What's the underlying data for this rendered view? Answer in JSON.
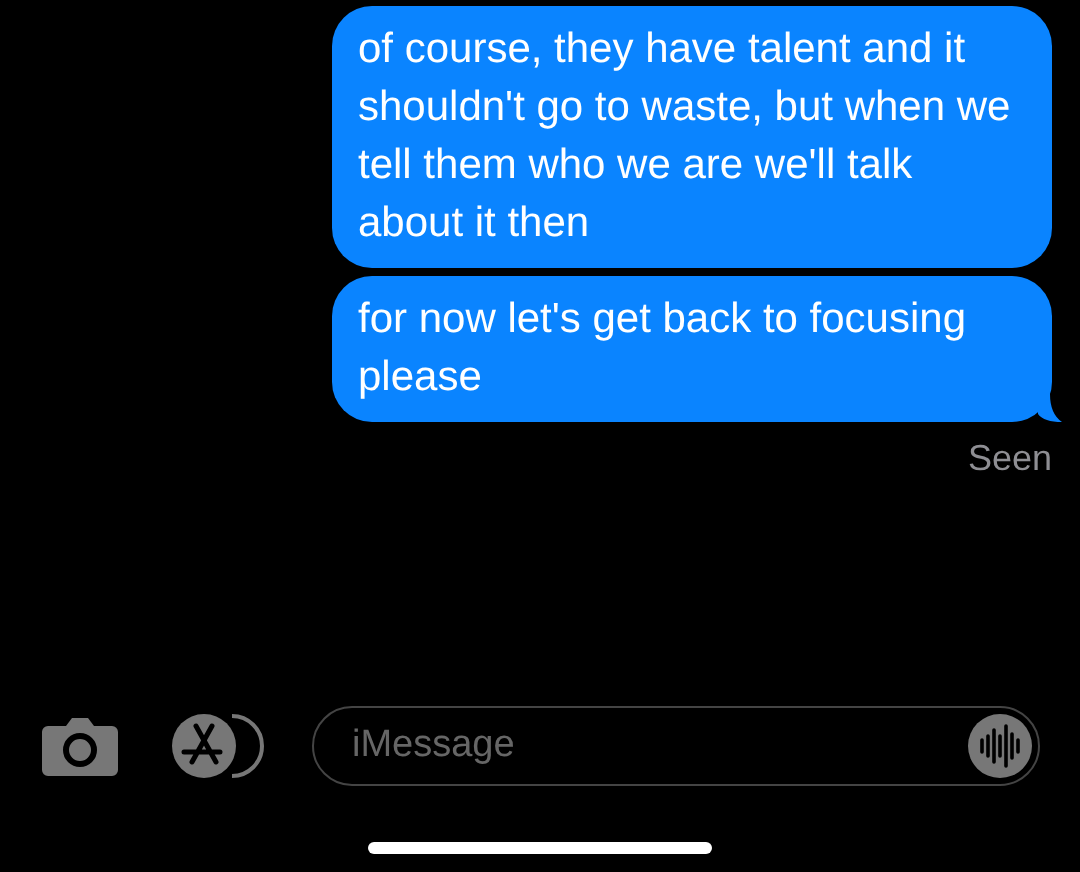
{
  "messages": [
    {
      "kind": "sent",
      "text": "of course, they have talent and it shouldn't go to waste, but when we tell them who we are we'll talk about it then",
      "tail": false
    },
    {
      "kind": "sent",
      "text": "for now let's get back to focusing please",
      "tail": true
    }
  ],
  "receipt": "Seen",
  "input": {
    "placeholder": "iMessage"
  }
}
